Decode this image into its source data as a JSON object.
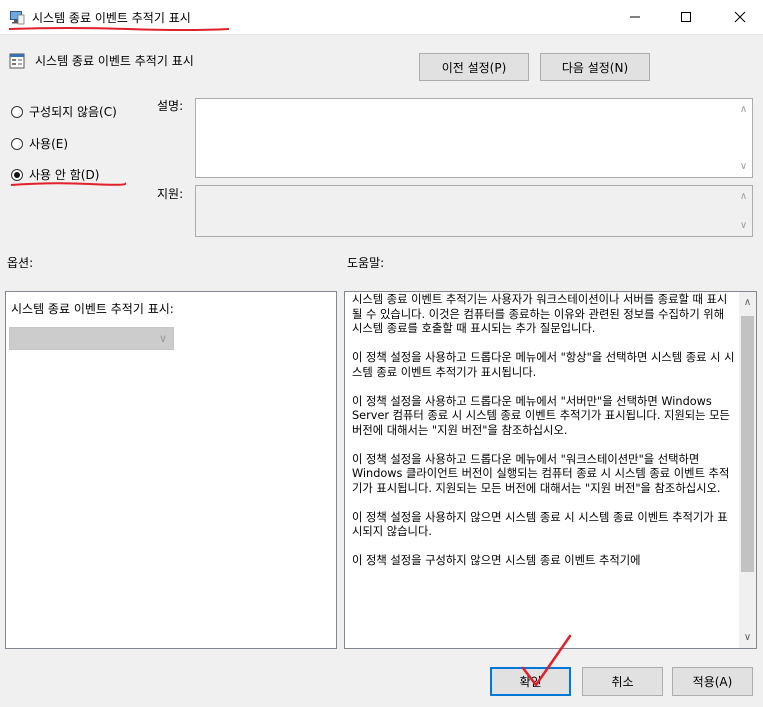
{
  "window": {
    "title": "시스템 종료 이벤트 추적기 표시",
    "icons": {
      "app": "policy-window-icon",
      "minimize": "minimize-icon",
      "maximize": "maximize-icon",
      "close": "close-icon"
    }
  },
  "header": {
    "policy_title": "시스템 종료 이벤트 추적기 표시",
    "policy_icon": "policy-setting-icon",
    "prev_button": "이전 설정(P)",
    "next_button": "다음 설정(N)"
  },
  "state": {
    "options": [
      {
        "label": "구성되지 않음(C)",
        "checked": false
      },
      {
        "label": "사용(E)",
        "checked": false
      },
      {
        "label": "사용 안 함(D)",
        "checked": true
      }
    ]
  },
  "comment": {
    "label": "설명:",
    "value": ""
  },
  "supported": {
    "label": "지원:",
    "value": ""
  },
  "options_section": {
    "label": "옵션:",
    "item_label": "시스템 종료 이벤트 추적기 표시:",
    "dropdown_value": ""
  },
  "help_section": {
    "label": "도움말:",
    "paragraphs": [
      "시스템 종료 이벤트 추적기는 사용자가 워크스테이션이나 서버를 종료할 때 표시될 수 있습니다.  이것은 컴퓨터를 종료하는 이유와 관련된 정보를 수집하기 위해 시스템 종료를 호출할 때 표시되는 추가 질문입니다.",
      "이 정책 설정을 사용하고 드롭다운 메뉴에서 \"항상\"을 선택하면 시스템 종료 시 시스템 종료 이벤트 추적기가 표시됩니다.",
      "이 정책 설정을 사용하고 드롭다운 메뉴에서 \"서버만\"을 선택하면 Windows Server 컴퓨터 종료 시 시스템 종료 이벤트 추적기가 표시됩니다. 지원되는 모든 버전에 대해서는 \"지원 버전\"을 참조하십시오.",
      "이 정책 설정을 사용하고 드롭다운 메뉴에서 \"워크스테이션만\"을 선택하면 Windows 클라이언트 버전이 실행되는 컴퓨터 종료 시 시스템 종료 이벤트 추적기가 표시됩니다. 지원되는 모든 버전에 대해서는 \"지원 버전\"을 참조하십시오.",
      "이 정책 설정을 사용하지 않으면 시스템 종료 시 시스템 종료 이벤트 추적기가 표시되지 않습니다.",
      "이 정책 설정을 구성하지 않으면 시스템 종료 이벤트 추적기에"
    ]
  },
  "footer": {
    "ok": "확인",
    "cancel": "취소",
    "apply": "적용(A)"
  },
  "colors": {
    "annotation": "#e0202a",
    "accent": "#0078d7"
  }
}
